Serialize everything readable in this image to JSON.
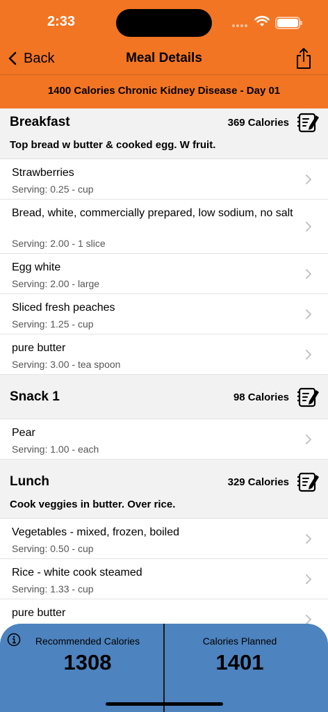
{
  "status": {
    "time": "2:33"
  },
  "nav": {
    "back_label": "Back",
    "title": "Meal Details"
  },
  "plan_title": "1400 Calories Chronic Kidney Disease - Day 01",
  "colors": {
    "header": "#f27523",
    "panel": "#4d83be"
  },
  "meals": [
    {
      "name": "Breakfast",
      "calories": "369 Calories",
      "description": "Top bread w butter & cooked egg. W fruit.",
      "foods": [
        {
          "name": "Strawberries",
          "serving": "Serving: 0.25 - cup"
        },
        {
          "name": "Bread, white, commercially prepared, low sodium, no salt",
          "serving": "Serving: 2.00 - 1 slice"
        },
        {
          "name": "Egg white",
          "serving": "Serving: 2.00 - large"
        },
        {
          "name": "Sliced fresh peaches",
          "serving": "Serving: 1.25 - cup"
        },
        {
          "name": "pure butter",
          "serving": "Serving: 3.00 - tea spoon"
        }
      ]
    },
    {
      "name": "Snack 1",
      "calories": "98 Calories",
      "description": "",
      "foods": [
        {
          "name": "Pear",
          "serving": "Serving: 1.00 - each"
        }
      ]
    },
    {
      "name": "Lunch",
      "calories": "329 Calories",
      "description": "Cook veggies in butter. Over rice.",
      "foods": [
        {
          "name": "Vegetables - mixed, frozen, boiled",
          "serving": "Serving: 0.50 - cup"
        },
        {
          "name": "Rice - white cook steamed",
          "serving": "Serving: 1.33 - cup"
        },
        {
          "name": "pure butter",
          "serving": ""
        }
      ]
    }
  ],
  "summary": {
    "recommended_label": "Recommended Calories",
    "recommended_value": "1308",
    "planned_label": "Calories Planned",
    "planned_value": "1401"
  }
}
